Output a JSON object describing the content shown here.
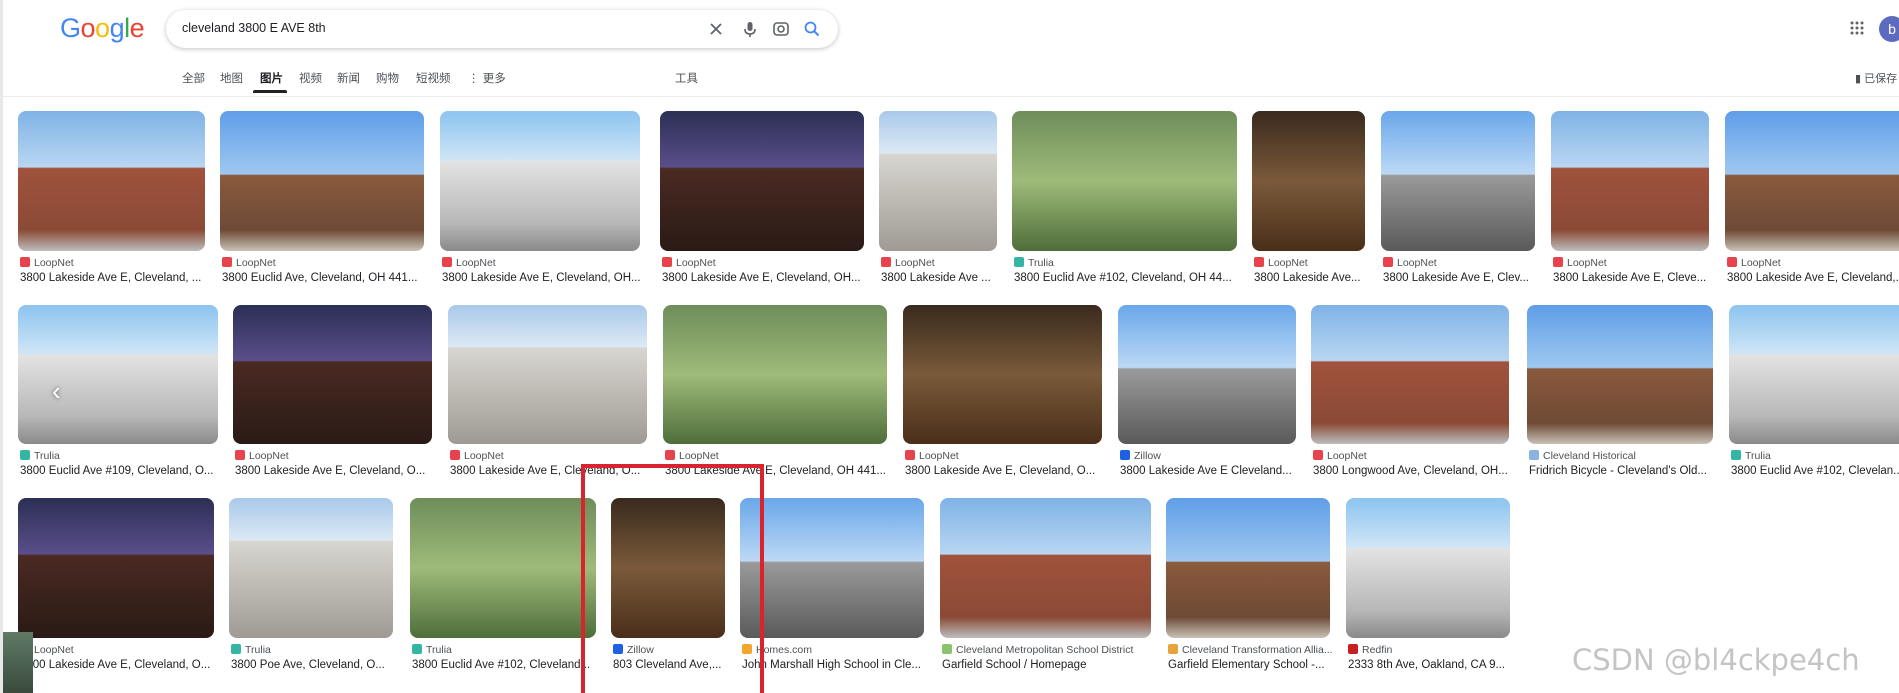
{
  "logo": "Google",
  "search": {
    "query": "cleveland 3800 E AVE 8th"
  },
  "avatar_letter": "b",
  "tabs": [
    "全部",
    "地图",
    "图片",
    "视频",
    "新闻",
    "购物",
    "短视频",
    "更多"
  ],
  "active_tab": "图片",
  "tools_label": "工具",
  "saved_label": "已保存",
  "watermark": "CSDN @bl4ckpe4ch",
  "colors": {
    "LoopNet": "#e8434d",
    "Trulia": "#35b5a4",
    "Zillow": "#1f5fe4",
    "Homes.com": "#f5a52b",
    "Cleveland Historical": "#8bb3e0",
    "Cleveland Metropolitan School District": "#8ac36b",
    "Cleveland Transformation Allia...": "#e8a33a",
    "Redfin": "#c82021",
    "highlight": "#d9232e"
  },
  "rows": [
    [
      {
        "source": "LoopNet",
        "title": "3800 Lakeside Ave E, Cleveland, ..."
      },
      {
        "source": "LoopNet",
        "title": "3800 Euclid Ave, Cleveland, OH 441..."
      },
      {
        "source": "LoopNet",
        "title": "3800 Lakeside Ave E, Cleveland, OH..."
      },
      {
        "source": "LoopNet",
        "title": "3800 Lakeside Ave E, Cleveland, OH..."
      },
      {
        "source": "LoopNet",
        "title": "3800 Lakeside Ave ..."
      },
      {
        "source": "Trulia",
        "title": "3800 Euclid Ave #102, Cleveland, OH 44..."
      },
      {
        "source": "LoopNet",
        "title": "3800 Lakeside Ave..."
      },
      {
        "source": "LoopNet",
        "title": "3800 Lakeside Ave E, Clev..."
      },
      {
        "source": "LoopNet",
        "title": "3800 Lakeside Ave E, Cleve..."
      },
      {
        "source": "LoopNet",
        "title": "3800 Lakeside Ave E, Cleveland,..."
      }
    ],
    [
      {
        "source": "Trulia",
        "title": "3800 Euclid Ave #109, Cleveland, O..."
      },
      {
        "source": "LoopNet",
        "title": "3800 Lakeside Ave E, Cleveland, O..."
      },
      {
        "source": "LoopNet",
        "title": "3800 Lakeside Ave E, Cleveland, O..."
      },
      {
        "source": "LoopNet",
        "title": "3800 Lakeside Ave E, Cleveland, OH 441..."
      },
      {
        "source": "LoopNet",
        "title": "3800 Lakeside Ave E, Cleveland, O..."
      },
      {
        "source": "Zillow",
        "title": "3800 Lakeside Ave E Cleveland..."
      },
      {
        "source": "LoopNet",
        "title": "3800 Longwood Ave, Cleveland, OH..."
      },
      {
        "source": "Cleveland Historical",
        "title": "Fridrich Bicycle - Cleveland's Old..."
      },
      {
        "source": "Trulia",
        "title": "3800 Euclid Ave #102, Clevelan..."
      }
    ],
    [
      {
        "source": "LoopNet",
        "title": "3800 Lakeside Ave E, Cleveland, O..."
      },
      {
        "source": "Trulia",
        "title": "3800 Poe Ave, Cleveland, O..."
      },
      {
        "source": "Trulia",
        "title": "3800 Euclid Ave #102, Cleveland..."
      },
      {
        "source": "Zillow",
        "title": "803 Cleveland Ave,..."
      },
      {
        "source": "Homes.com",
        "title": "John Marshall High School in Cle..."
      },
      {
        "source": "Cleveland Metropolitan School District",
        "title": "Garfield School / Homepage"
      },
      {
        "source": "Cleveland Transformation Allia...",
        "title": "Garfield Elementary School -..."
      },
      {
        "source": "Redfin",
        "title": "2333 8th Ave, Oakland, CA 9..."
      }
    ]
  ]
}
